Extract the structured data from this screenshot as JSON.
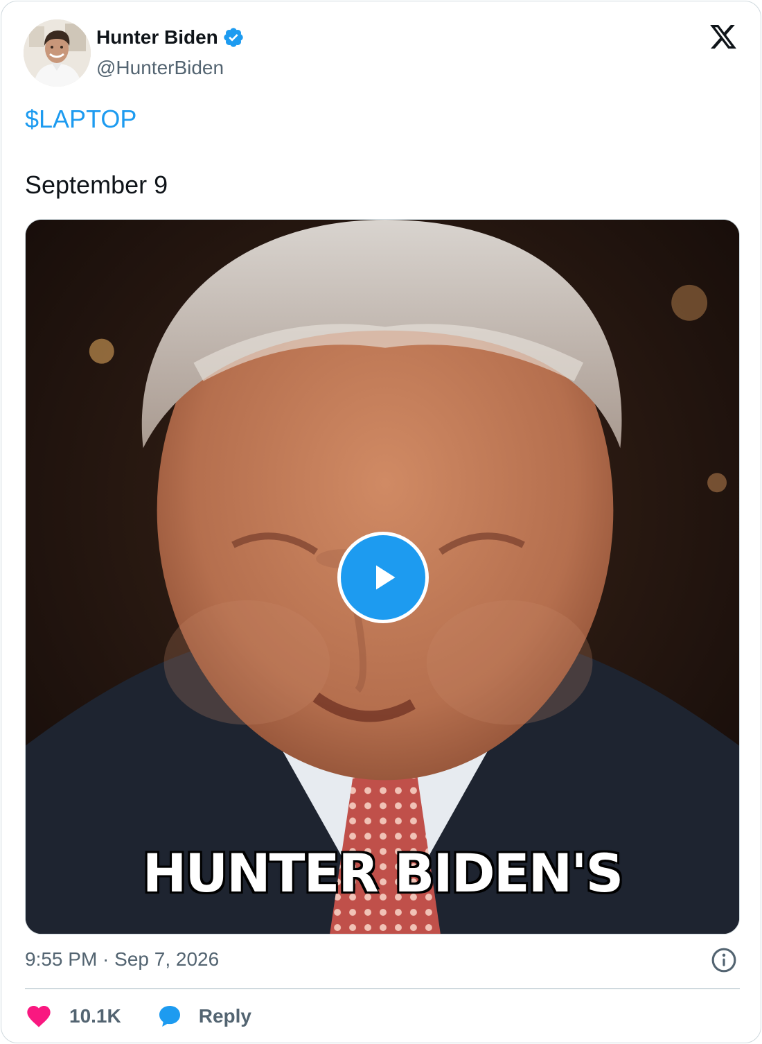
{
  "author": {
    "name": "Hunter Biden",
    "handle": "@HunterBiden",
    "verified": true
  },
  "tweet": {
    "cashtag": "$LAPTOP",
    "text": "September 9",
    "media": {
      "type": "video",
      "caption_text": "HUNTER BIDEN'S"
    },
    "timestamp": "9:55 PM · Sep 7, 2026"
  },
  "actions": {
    "like_count": "10.1K",
    "reply_label": "Reply"
  },
  "icons": {
    "verified": "verified-badge-icon",
    "brand": "x-logo-icon",
    "play": "play-icon",
    "info": "info-icon",
    "like": "heart-icon",
    "reply": "speech-bubble-icon"
  },
  "colors": {
    "accent": "#1d9bf0",
    "like": "#f91880",
    "text": "#0f1419",
    "secondary_text": "#536471",
    "border": "#cfd9de"
  }
}
